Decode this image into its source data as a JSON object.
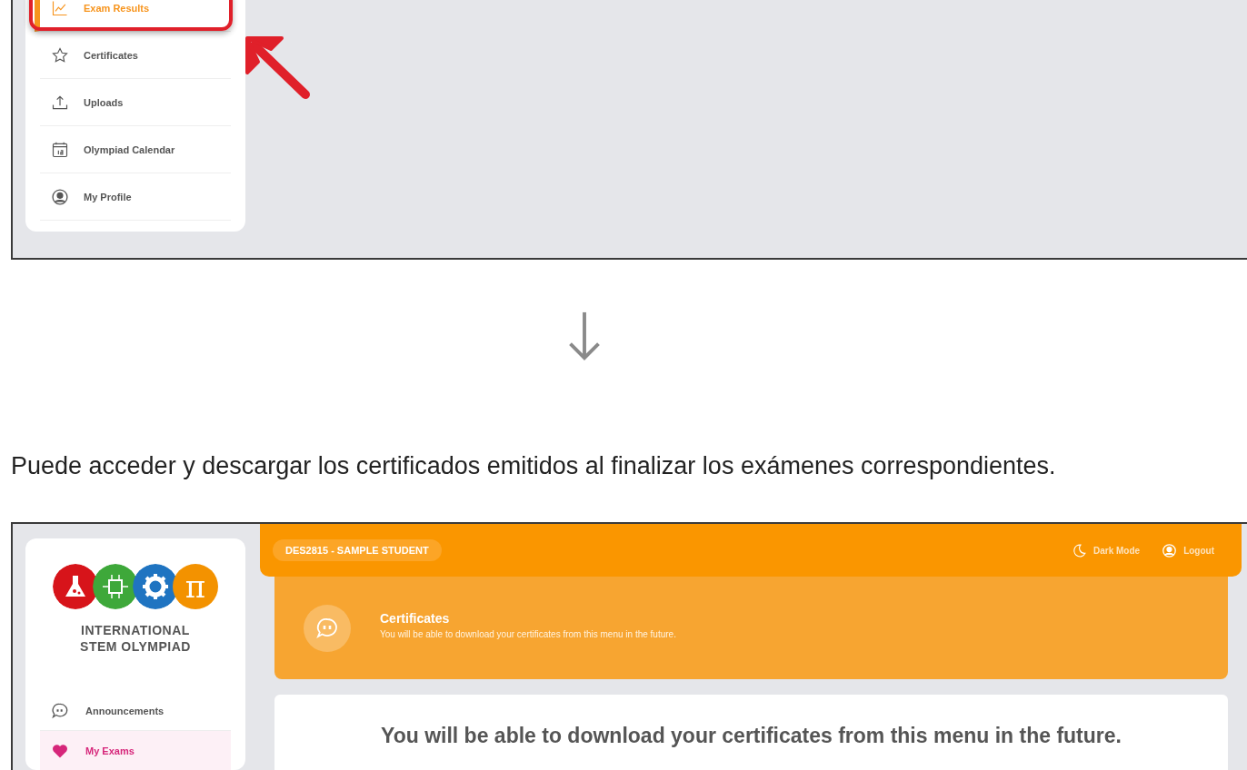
{
  "top_screenshot": {
    "sidebar": {
      "items": [
        {
          "label": "Exam Results",
          "selected": true
        },
        {
          "label": "Certificates",
          "selected": false
        },
        {
          "label": "Uploads",
          "selected": false
        },
        {
          "label": "Olympiad Calendar",
          "selected": false
        },
        {
          "label": "My Profile",
          "selected": false
        }
      ]
    }
  },
  "caption": "Puede acceder y descargar los certificados emitidos al finalizar los exámenes correspondientes.",
  "bottom_screenshot": {
    "logo": {
      "symbol": "π",
      "name_lines": [
        "INTERNATIONAL",
        "STEM OLYMPIAD"
      ]
    },
    "sidebar": {
      "items": [
        {
          "label": "Announcements",
          "selected": false
        },
        {
          "label": "My Exams",
          "selected": true
        }
      ]
    },
    "header": {
      "user": "DES2815 - SAMPLE STUDENT",
      "actions": [
        "Dark Mode",
        "Logout"
      ]
    },
    "banner": {
      "title": "Certificates",
      "subtitle": "You will be able to download your certificates from this menu in the future."
    },
    "message": "You will be able to download your certificates from this menu in the future."
  }
}
